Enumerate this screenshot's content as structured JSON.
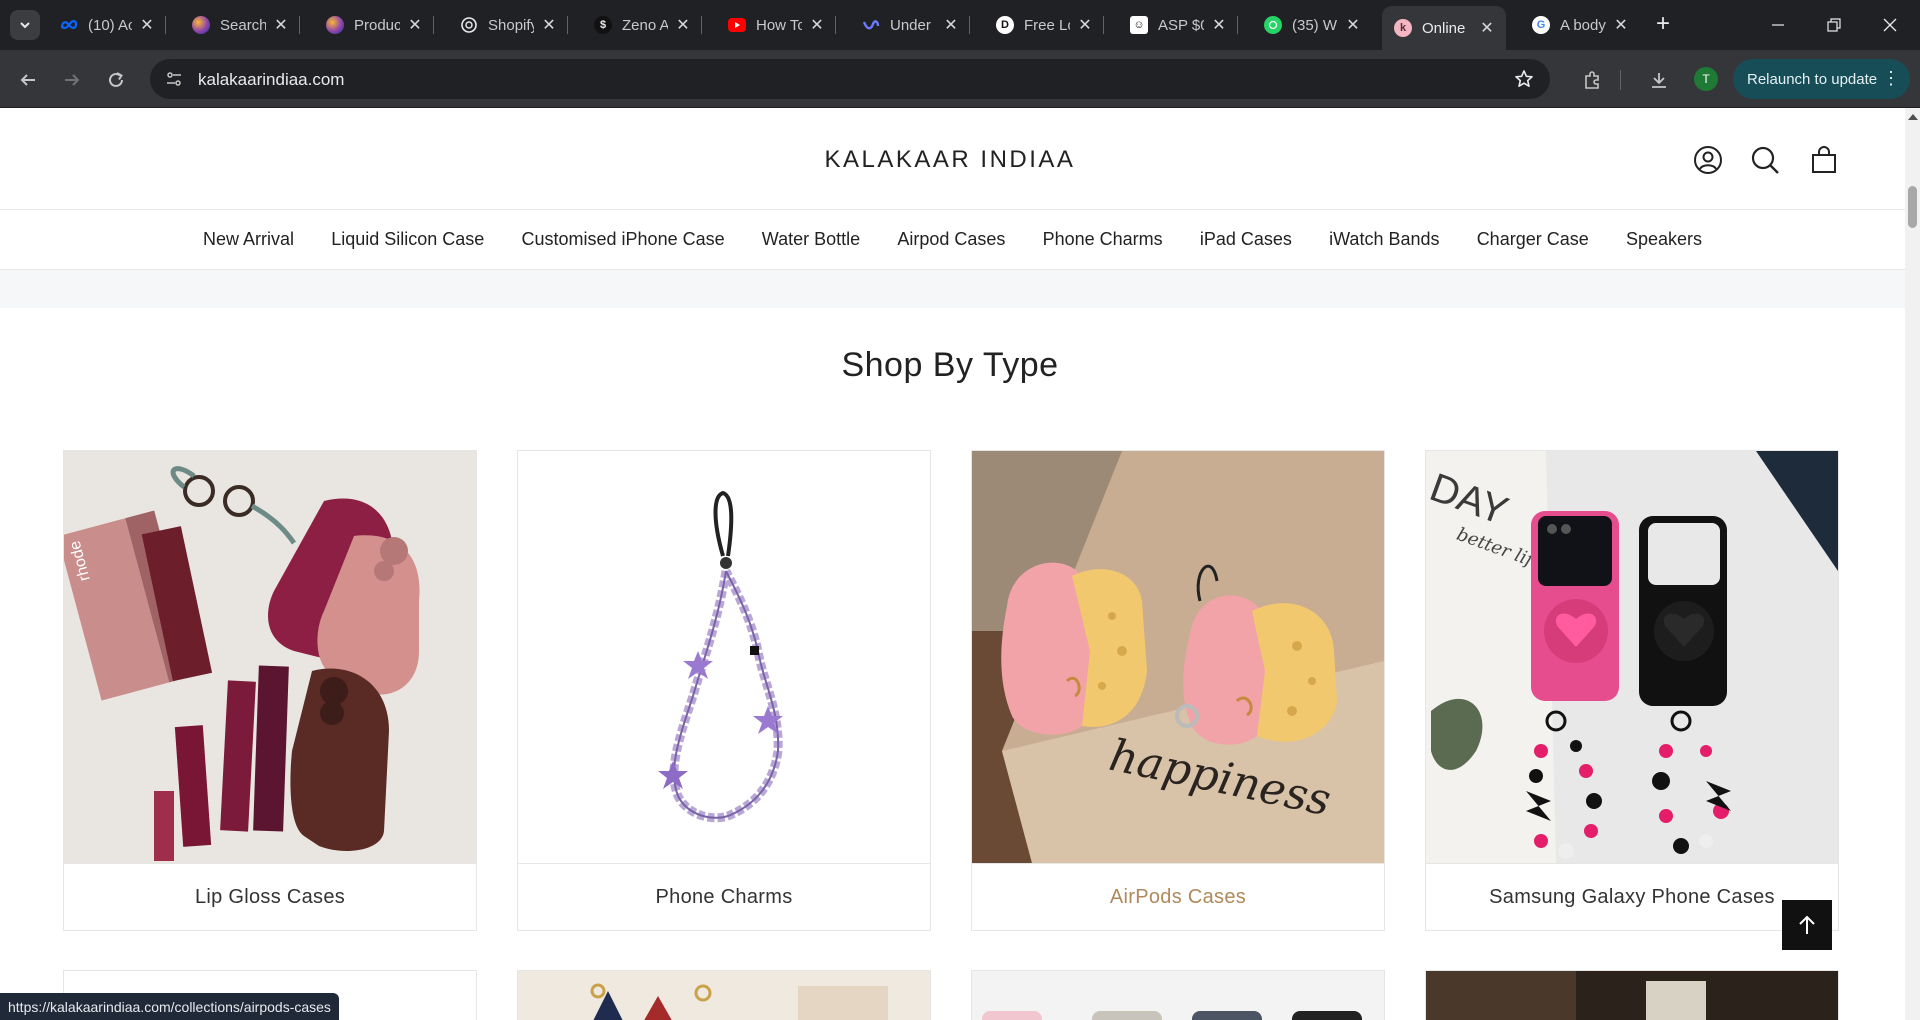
{
  "browser": {
    "tabs": [
      {
        "title": "(10) Ac",
        "favicon": "meta-icon",
        "color": "#0866ff"
      },
      {
        "title": "Search",
        "favicon": "gemini-icon",
        "color": "#8e44ad"
      },
      {
        "title": "Produc",
        "favicon": "gemini-icon",
        "color": "#8e44ad"
      },
      {
        "title": "Shopify",
        "favicon": "openai-icon",
        "color": "#ffffff"
      },
      {
        "title": "Zeno A",
        "favicon": "zeno-icon",
        "color": "#e05d2a"
      },
      {
        "title": "How Tc",
        "favicon": "youtube-icon",
        "color": "#ff0000"
      },
      {
        "title": "Under",
        "favicon": "underline-icon",
        "color": "#5865f2"
      },
      {
        "title": "Free Lo",
        "favicon": "free-logo-icon",
        "color": "#ffffff"
      },
      {
        "title": "ASP $0",
        "favicon": "asp-icon",
        "color": "#ffffff"
      },
      {
        "title": "(35) W",
        "favicon": "whatsapp-icon",
        "color": "#25d366"
      },
      {
        "title": "Online",
        "favicon": "kalakaar-icon",
        "color": "#f4b6c2",
        "active": true
      },
      {
        "title": "A body",
        "favicon": "google-icon",
        "color": "#4285f4"
      }
    ],
    "url": "kalakaarindiaa.com",
    "profile_initial": "T",
    "relaunch_label": "Relaunch to update",
    "status_url": "https://kalakaarindiaa.com/collections/airpods-cases"
  },
  "site": {
    "logo": "KALAKAAR INDIAA",
    "nav": [
      "New Arrival",
      "Liquid Silicon Case",
      "Customised iPhone Case",
      "Water Bottle",
      "Airpod Cases",
      "Phone Charms",
      "iPad Cases",
      "iWatch Bands",
      "Charger Case",
      "Speakers"
    ],
    "section_title": "Shop By Type",
    "cards": [
      {
        "label": "Lip Gloss Cases"
      },
      {
        "label": "Phone Charms"
      },
      {
        "label": "AirPods Cases",
        "hover": true
      },
      {
        "label": "Samsung Galaxy Phone Cases"
      }
    ],
    "image_text": {
      "happiness": "happiness",
      "day": "DAY",
      "better_life": "better life",
      "rhode": "rhode"
    },
    "colors": {
      "accent_hover": "#b0895a",
      "text": "#222222"
    }
  }
}
